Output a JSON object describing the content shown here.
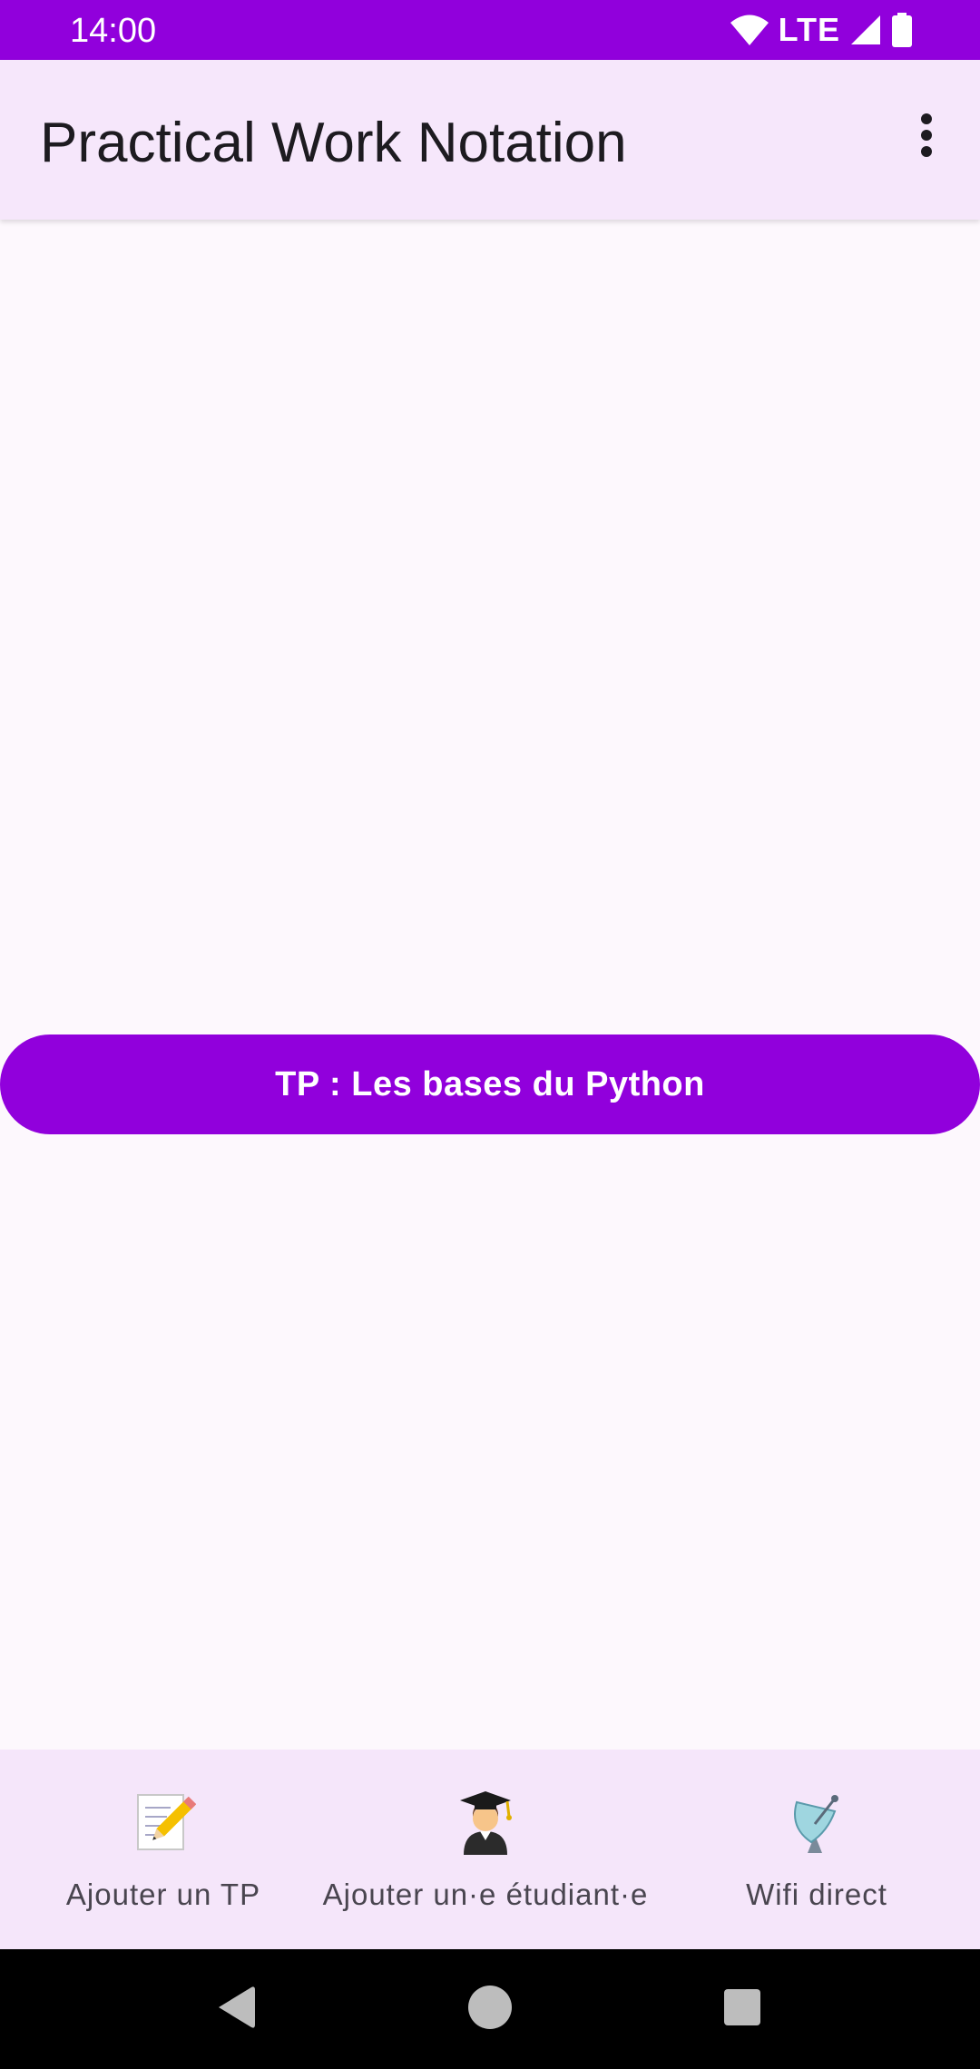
{
  "status_bar": {
    "time": "14:00",
    "network": "LTE",
    "icons": [
      "wifi-icon",
      "cell-signal-icon",
      "battery-icon"
    ],
    "color": "#9100dc"
  },
  "app_bar": {
    "title": "Practical Work Notation",
    "menu_icon": "more-vert-icon"
  },
  "main": {
    "tp_button_label": "TP : Les bases du Python"
  },
  "bottom_nav": {
    "items": [
      {
        "label": "Ajouter un TP",
        "icon": "memo-pencil-icon"
      },
      {
        "label": "Ajouter un·e étudiant·e",
        "icon": "student-icon"
      },
      {
        "label": "Wifi direct",
        "icon": "satellite-antenna-icon"
      }
    ]
  },
  "system_nav": {
    "buttons": [
      "back-icon",
      "home-icon",
      "recents-icon"
    ]
  },
  "colors": {
    "accent": "#9100dc",
    "app_bar_bg": "#f6e7fb",
    "background": "#fdf8fd",
    "bottom_nav_bg": "#f5e6fa"
  }
}
